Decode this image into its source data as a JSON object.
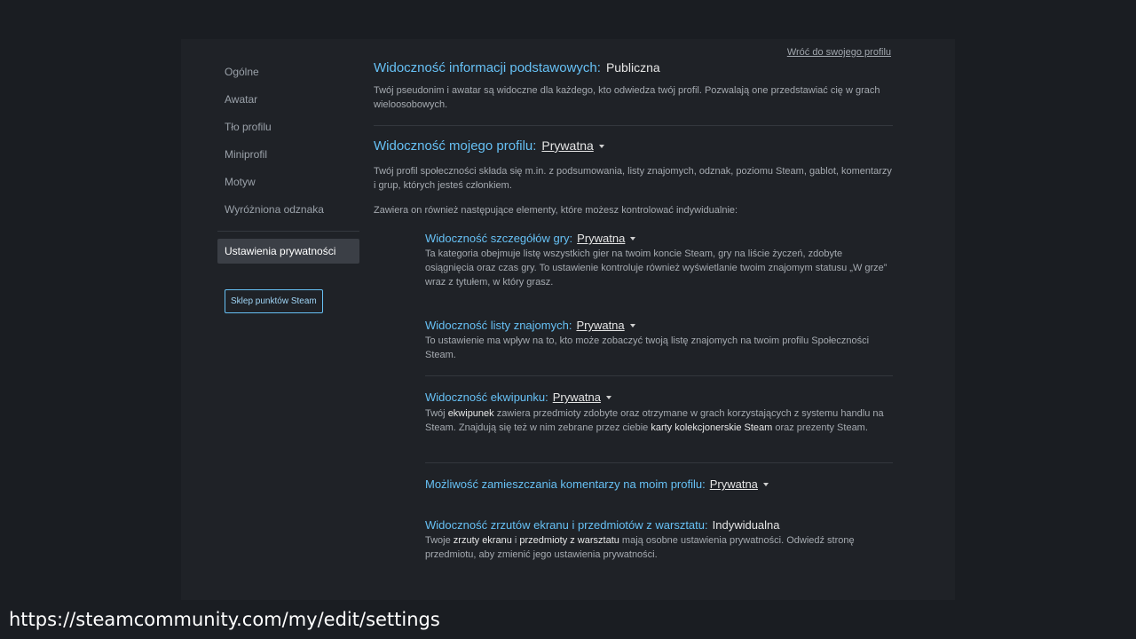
{
  "back_link": "Wróć do swojego profilu",
  "sidebar": {
    "items": [
      {
        "label": "Ogólne"
      },
      {
        "label": "Awatar"
      },
      {
        "label": "Tło profilu"
      },
      {
        "label": "Miniprofil"
      },
      {
        "label": "Motyw"
      },
      {
        "label": "Wyróżniona odznaka"
      }
    ],
    "active_item": "Ustawienia prywatności",
    "shop_button": "Sklep punktów Steam"
  },
  "basic_info": {
    "title": "Widoczność informacji podstawowych:",
    "value": "Publiczna",
    "description": "Twój pseudonim i awatar są widoczne dla każdego, kto odwiedza twój profil. Pozwalają one przedstawiać cię w grach wieloosobowych."
  },
  "profile": {
    "title": "Widoczność mojego profilu:",
    "value": "Prywatna",
    "description": "Twój profil społeczności składa się m.in. z podsumowania, listy znajomych, odznak, poziomu Steam, gablot, komentarzy i grup, których jesteś członkiem.",
    "description2": "Zawiera on również następujące elementy, które możesz kontrolować indywidualnie:"
  },
  "game_details": {
    "title": "Widoczność szczegółów gry:",
    "value": "Prywatna",
    "description": "Ta kategoria obejmuje listę wszystkich gier na twoim koncie Steam, gry na liście życzeń, zdobyte osiągnięcia oraz czas gry. To ustawienie kontroluje również wyświetlanie twoim znajomym statusu „W grze” wraz z tytułem, w który grasz."
  },
  "friends_list": {
    "title": "Widoczność listy znajomych:",
    "value": "Prywatna",
    "description": "To ustawienie ma wpływ na to, kto może zobaczyć twoją listę znajomych na twoim profilu Społeczności Steam."
  },
  "inventory": {
    "title": "Widoczność ekwipunku:",
    "value": "Prywatna",
    "desc_a": "Twój ",
    "desc_b": "ekwipunek",
    "desc_c": " zawiera przedmioty zdobyte oraz otrzymane w grach korzystających z systemu handlu na Steam. Znajdują się też w nim zebrane przez ciebie ",
    "desc_d": "karty kolekcjonerskie Steam",
    "desc_e": " oraz prezenty Steam."
  },
  "comments": {
    "title": "Możliwość zamieszczania komentarzy na moim profilu:",
    "value": "Prywatna"
  },
  "screenshots": {
    "title": "Widoczność zrzutów ekranu i przedmiotów z warsztatu:",
    "value": "Indywidualna",
    "desc_a": "Twoje ",
    "desc_b": "zrzuty ekranu",
    "desc_c": " i ",
    "desc_d": "przedmioty z warsztatu",
    "desc_e": " mają osobne ustawienia prywatności. Odwiedź stronę przedmiotu, aby zmienić jego ustawienia prywatności."
  },
  "url_caption": "https://steamcommunity.com/my/edit/settings"
}
